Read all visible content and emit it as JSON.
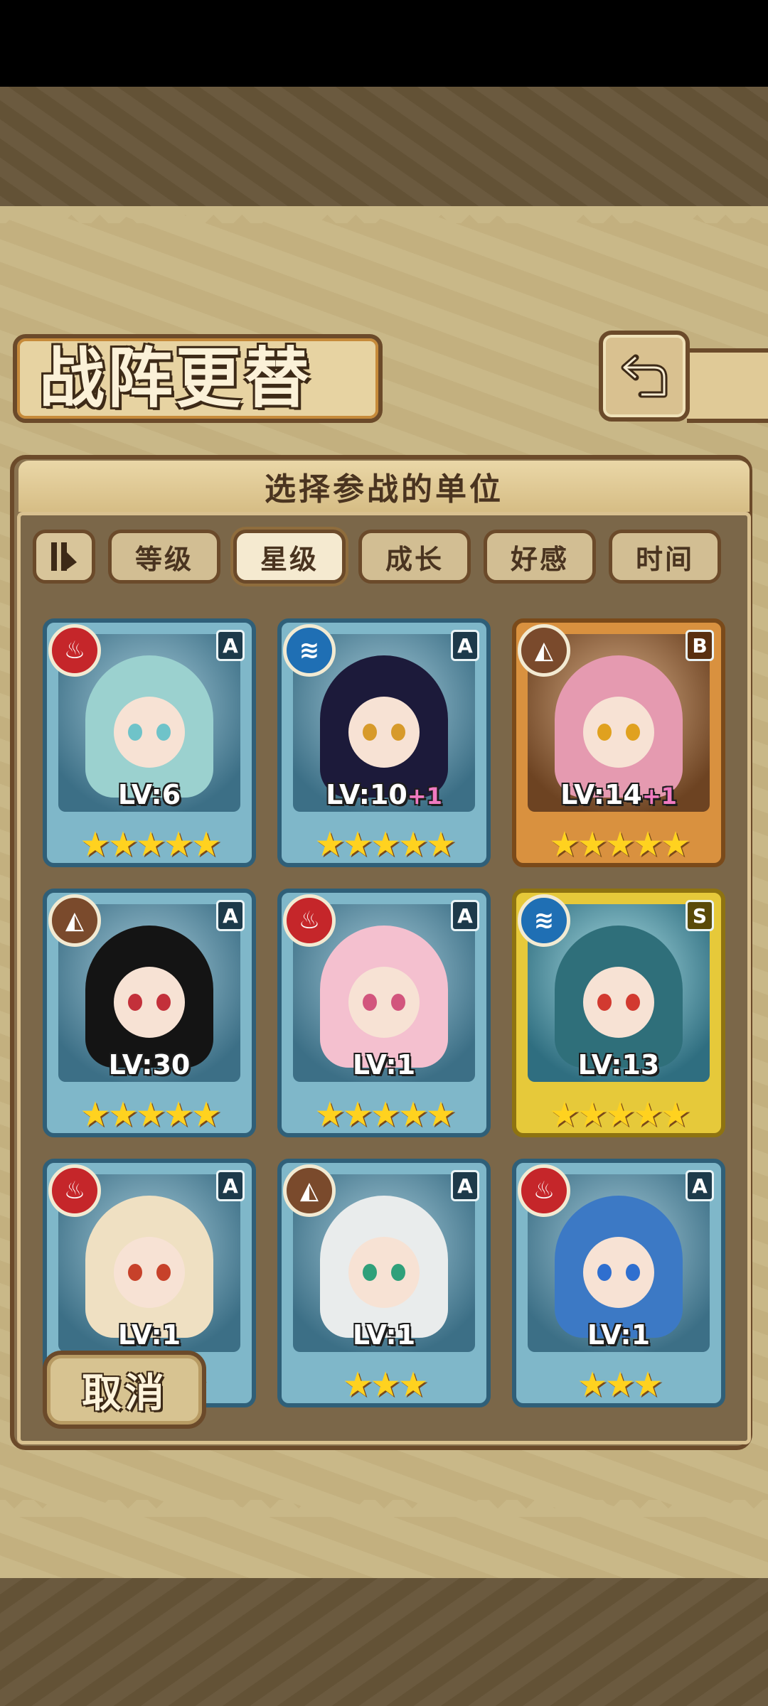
{
  "header": {
    "title": "战阵更替",
    "back_icon": "return-arrow-icon"
  },
  "panel": {
    "subtitle": "选择参战的单位"
  },
  "sort": {
    "toggle_icon": "sort-order-icon",
    "buttons": [
      {
        "label": "等级",
        "active": false
      },
      {
        "label": "星级",
        "active": true
      },
      {
        "label": "成长",
        "active": false
      },
      {
        "label": "好感",
        "active": false
      },
      {
        "label": "时间",
        "active": false
      }
    ]
  },
  "units": [
    {
      "element": "fire",
      "rank": "A",
      "level": "LV:6",
      "bonus": "",
      "stars": "★★★★★",
      "frame": "teal",
      "hair": "#9bd1cf",
      "eye": "#6fc3c9"
    },
    {
      "element": "water",
      "rank": "A",
      "level": "LV:10",
      "bonus": "+1",
      "stars": "★★★★★",
      "frame": "teal",
      "hair": "#1c1a3a",
      "eye": "#d79a2a"
    },
    {
      "element": "earth",
      "rank": "B",
      "level": "LV:14",
      "bonus": "+1",
      "stars": "★★★★★",
      "frame": "bronze",
      "hair": "#e59ab0",
      "eye": "#e0a11f"
    },
    {
      "element": "earth",
      "rank": "A",
      "level": "LV:30",
      "bonus": "",
      "stars": "★★★★★",
      "frame": "teal",
      "hair": "#141414",
      "eye": "#c3303a"
    },
    {
      "element": "fire",
      "rank": "A",
      "level": "LV:1",
      "bonus": "",
      "stars": "★★★★★",
      "frame": "teal",
      "hair": "#f4c0cf",
      "eye": "#d2557d"
    },
    {
      "element": "water",
      "rank": "S",
      "level": "LV:13",
      "bonus": "",
      "stars": "★★★★★",
      "frame": "gold",
      "hair": "#2f6f7a",
      "eye": "#d23a30"
    },
    {
      "element": "fire",
      "rank": "A",
      "level": "LV:1",
      "bonus": "",
      "stars": "★★★★",
      "frame": "teal",
      "hair": "#efe0c2",
      "eye": "#c7412a"
    },
    {
      "element": "earth",
      "rank": "A",
      "level": "LV:1",
      "bonus": "",
      "stars": "★★★",
      "frame": "teal",
      "hair": "#e9ecec",
      "eye": "#2fa07a"
    },
    {
      "element": "fire",
      "rank": "A",
      "level": "LV:1",
      "bonus": "",
      "stars": "★★★",
      "frame": "teal",
      "hair": "#3c79c5",
      "eye": "#2f6fcf"
    }
  ],
  "footer": {
    "cancel_label": "取消"
  },
  "colors": {
    "fire": "#c5262a",
    "water": "#1f6fb4",
    "earth": "#7a4a2c",
    "star": "#ffd21f"
  }
}
